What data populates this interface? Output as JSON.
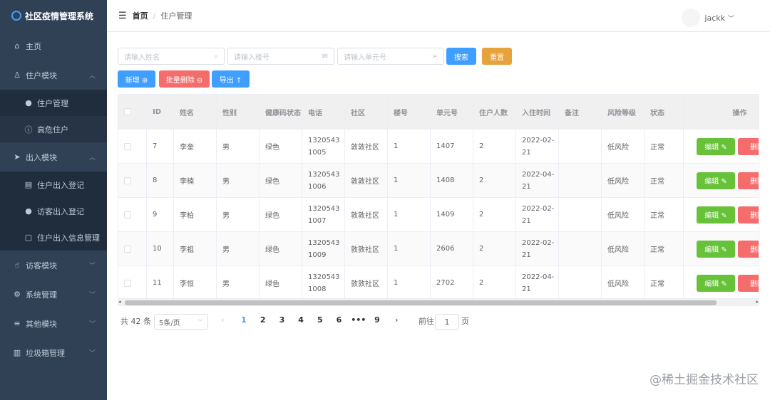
{
  "sidebar": {
    "title": "社区疫情管理系统",
    "items": [
      {
        "label": "主页",
        "icon": "home-icon",
        "glyph": "⌂",
        "type": "mi"
      },
      {
        "label": "住户模块",
        "icon": "user-icon",
        "glyph": "♙",
        "type": "mi",
        "chev": "︿"
      },
      {
        "label": "住户管理",
        "icon": "person-icon",
        "glyph": "●",
        "type": "sub"
      },
      {
        "label": "高危住户",
        "icon": "warning-icon",
        "glyph": "ⓘ",
        "type": "sub",
        "active": true
      },
      {
        "label": "出入模块",
        "icon": "send-icon",
        "glyph": "➤",
        "type": "mi",
        "chev": "︿"
      },
      {
        "label": "住户出入登记",
        "icon": "document-icon",
        "glyph": "▤",
        "type": "sub"
      },
      {
        "label": "访客出入登记",
        "icon": "person-icon",
        "glyph": "●",
        "type": "sub"
      },
      {
        "label": "住户出入信息管理",
        "icon": "file-icon",
        "glyph": "▢",
        "type": "sub"
      },
      {
        "label": "访客模块",
        "icon": "thumb-icon",
        "glyph": "☝",
        "type": "mi",
        "chev": "﹀"
      },
      {
        "label": "系统管理",
        "icon": "gear-icon",
        "glyph": "⚙",
        "type": "mi",
        "chev": "﹀"
      },
      {
        "label": "其他模块",
        "icon": "menu-icon",
        "glyph": "≡",
        "type": "mi",
        "chev": "﹀"
      },
      {
        "label": "垃圾箱管理",
        "icon": "trash-icon",
        "glyph": "▥",
        "type": "mi",
        "chev": "﹀"
      }
    ]
  },
  "header": {
    "breadcrumb_home": "首页",
    "breadcrumb_sep": "/",
    "breadcrumb_current": "住户管理",
    "username": "jackk",
    "user_chev": "﹀"
  },
  "search": {
    "name_placeholder": "请输入姓名",
    "building_placeholder": "请输入楼号",
    "unit_placeholder": "请输入单元号",
    "search_label": "搜索",
    "reset_label": "重置"
  },
  "toolbar": {
    "add_label": "新增 ⊕",
    "batch_delete_label": "批量删除 ⊖",
    "export_label": "导出 ↑"
  },
  "table": {
    "columns": [
      "",
      "ID",
      "姓名",
      "性别",
      "健康码状态",
      "电话",
      "社区",
      "楼号",
      "单元号",
      "住户人数",
      "入住时间",
      "备注",
      "风险等级",
      "状态",
      "操作"
    ],
    "rows": [
      [
        "",
        "7",
        "李奎",
        "男",
        "绿色",
        "13205431005",
        "敦敦社区",
        "1",
        "1407",
        "2",
        "2022-02-21",
        "",
        "低风险",
        "正常"
      ],
      [
        "",
        "8",
        "李楠",
        "男",
        "绿色",
        "13205431006",
        "敦敦社区",
        "1",
        "1408",
        "2",
        "2022-04-21",
        "",
        "低风险",
        "正常"
      ],
      [
        "",
        "9",
        "李柏",
        "男",
        "绿色",
        "13205431007",
        "敦敦社区",
        "1",
        "1409",
        "2",
        "2022-02-21",
        "",
        "低风险",
        "正常"
      ],
      [
        "",
        "10",
        "李祖",
        "男",
        "绿色",
        "13205431009",
        "敦敦社区",
        "1",
        "2606",
        "2",
        "2022-02-21",
        "",
        "低风险",
        "正常"
      ],
      [
        "",
        "11",
        "李恒",
        "男",
        "绿色",
        "13205431008",
        "敦敦社区",
        "1",
        "2702",
        "2",
        "2022-04-21",
        "",
        "低风险",
        "正常"
      ]
    ],
    "edit_label": "编辑 ✎",
    "delete_label": "删除"
  },
  "pagination": {
    "total": "共 42 条",
    "page_size": "5条/页",
    "pages": [
      "1",
      "2",
      "3",
      "4",
      "5",
      "6",
      "•••",
      "9"
    ],
    "prev": "‹",
    "next": "›",
    "goto_prefix": "前往",
    "goto_value": "1",
    "goto_suffix": "页"
  },
  "watermark": "@稀土掘金技术社区",
  "colors": {
    "sidebar_bg": "#304156",
    "primary": "#409eff",
    "danger": "#f56c6c",
    "warning": "#e6a23c",
    "success": "#67c23a"
  }
}
